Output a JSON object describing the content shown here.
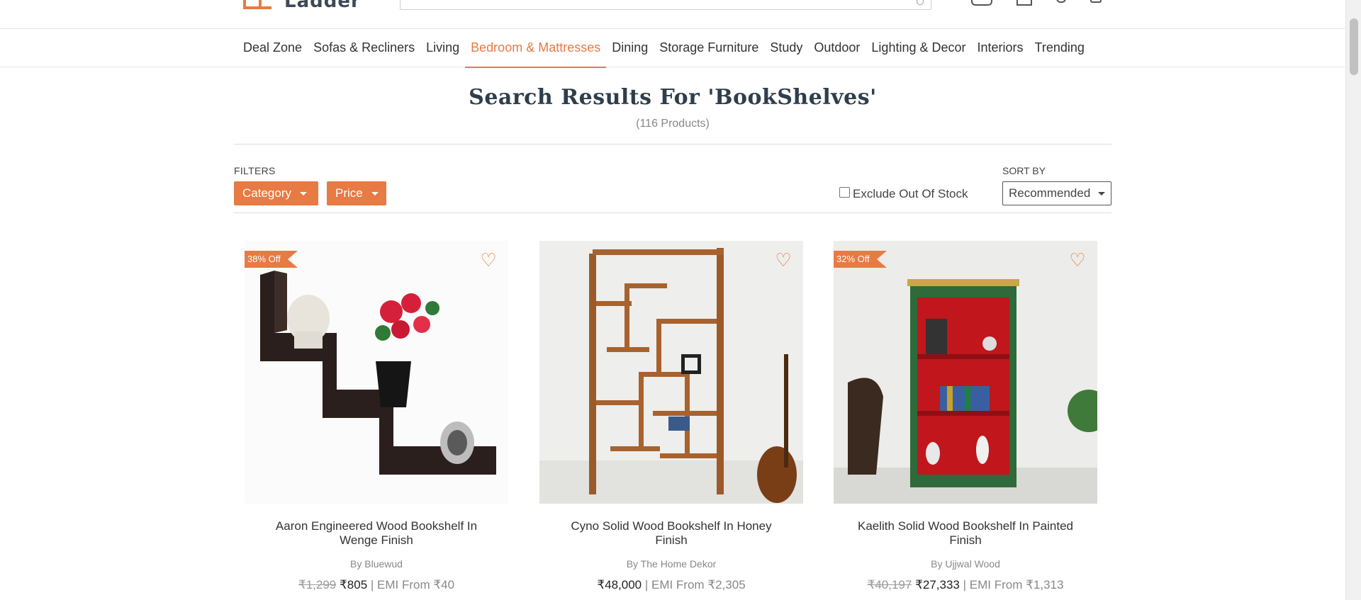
{
  "header": {
    "logo_text": "Ladder",
    "icons": [
      "truck-icon",
      "user-icon",
      "heart-icon",
      "cart-icon"
    ]
  },
  "nav": {
    "items": [
      {
        "label": "Deal Zone",
        "active": false
      },
      {
        "label": "Sofas & Recliners",
        "active": false
      },
      {
        "label": "Living",
        "active": false
      },
      {
        "label": "Bedroom & Mattresses",
        "active": true
      },
      {
        "label": "Dining",
        "active": false
      },
      {
        "label": "Storage Furniture",
        "active": false
      },
      {
        "label": "Study",
        "active": false
      },
      {
        "label": "Outdoor",
        "active": false
      },
      {
        "label": "Lighting & Decor",
        "active": false
      },
      {
        "label": "Interiors",
        "active": false
      },
      {
        "label": "Trending",
        "active": false
      }
    ]
  },
  "results": {
    "title": "Search Results For 'BookShelves'",
    "count": "(116 Products)"
  },
  "filters": {
    "label": "FILTERS",
    "category_label": "Category",
    "price_label": "Price",
    "exclude_label": "Exclude Out Of Stock",
    "exclude_checked": false
  },
  "sort": {
    "label": "SORT BY",
    "selected": "Recommended"
  },
  "products": [
    {
      "name": "Aaron Engineered Wood Bookshelf In Wenge Finish",
      "brand": "By Bluewud",
      "discount": "38% Off",
      "mrp": "₹1,299",
      "price": "₹805",
      "emi": " | EMI From ₹40"
    },
    {
      "name": "Cyno Solid Wood Bookshelf In Honey Finish",
      "brand": "By The Home Dekor",
      "discount": "",
      "mrp": "",
      "price": "₹48,000",
      "emi": " | EMI From ₹2,305"
    },
    {
      "name": "Kaelith Solid Wood Bookshelf In Painted Finish",
      "brand": "By Ujjwal Wood",
      "discount": "32% Off",
      "mrp": "₹40,197",
      "price": "₹27,333",
      "emi": " | EMI From ₹1,313"
    }
  ],
  "colors": {
    "accent": "#e87a44",
    "title": "#2f3e4c"
  }
}
